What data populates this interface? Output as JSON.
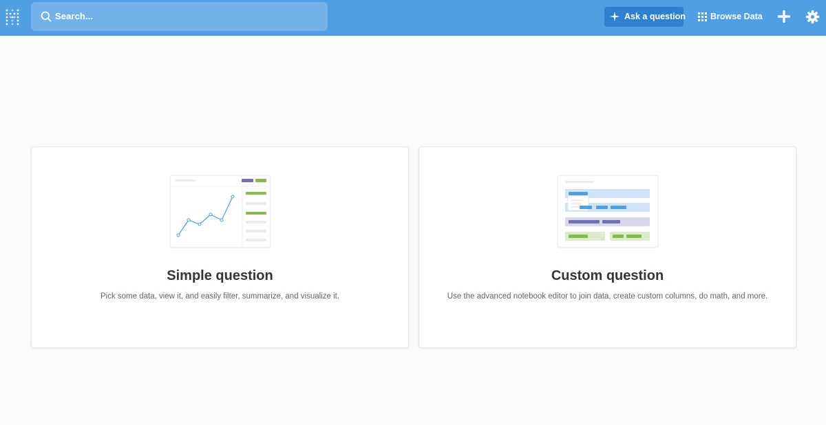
{
  "topbar": {
    "search_placeholder": "Search...",
    "ask_button_label": "Ask a question",
    "browse_label": "Browse Data",
    "colors": {
      "bar": "#509ee3",
      "search_bg": "#73b1e8",
      "ask_bg": "#2f80cf"
    }
  },
  "icons": {
    "logo": "logo-icon",
    "search": "search-icon",
    "ask": "sparkle-icon",
    "browse": "grid-icon",
    "new": "plus-icon",
    "settings": "gear-icon"
  },
  "cards": [
    {
      "title": "Simple question",
      "description": "Pick some data, view it, and easily filter, summarize, and visualize it."
    },
    {
      "title": "Custom question",
      "description": "Use the advanced notebook editor to join data, create custom columns, do math, and more."
    }
  ],
  "colors": {
    "accent_blue": "#509ee3",
    "accent_green": "#84bb4c",
    "accent_purple": "#7172ad"
  }
}
